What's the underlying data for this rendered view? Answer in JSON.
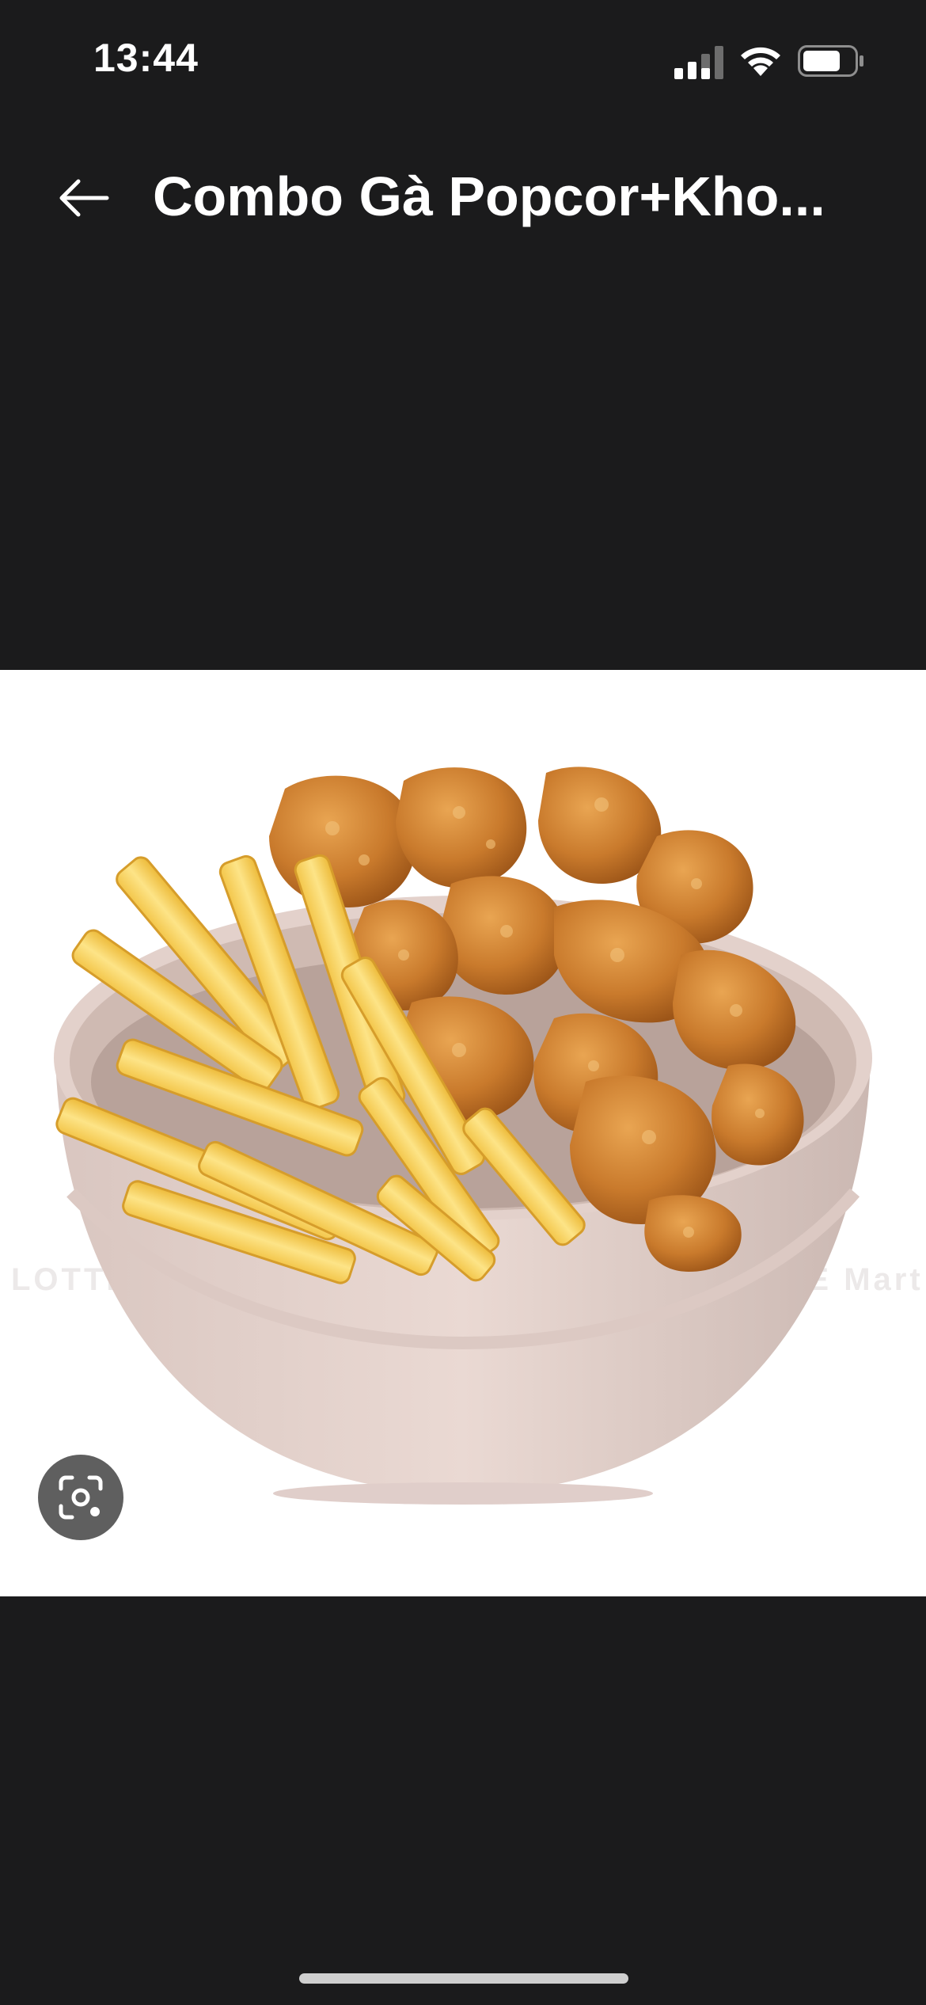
{
  "status_bar": {
    "time": "13:44",
    "icons": [
      "signal-icon",
      "wifi-icon",
      "battery-icon"
    ]
  },
  "header": {
    "back_icon": "arrow-left-icon",
    "title": "Combo Gà Popcor+Kho..."
  },
  "product_image": {
    "description_icon": "food-photo",
    "watermark_left": "LOTTE Mart",
    "watermark_right": "LOTTE Mart"
  },
  "lens_button": {
    "icon": "visual-search-icon"
  },
  "colors": {
    "background": "#1b1b1c",
    "image_background": "#ffffff",
    "text": "#ffffff",
    "lens_button": "#5f5f5f",
    "home_indicator": "#cfcfcf"
  }
}
